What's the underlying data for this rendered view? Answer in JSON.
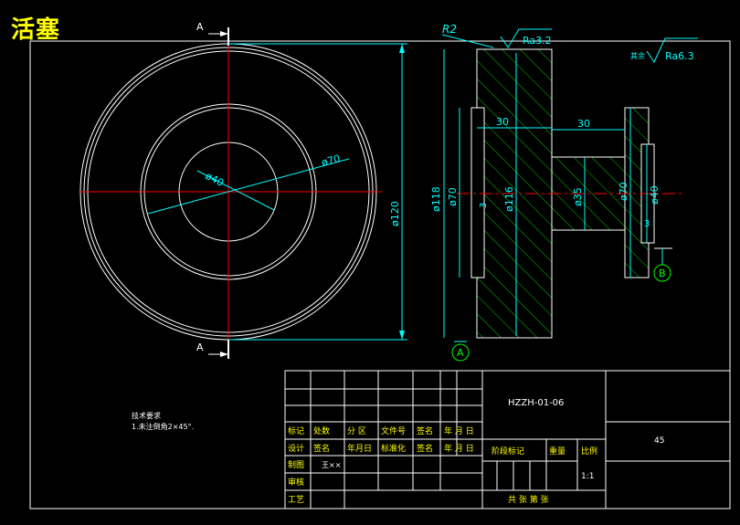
{
  "drawing": {
    "title": "活塞",
    "section_label_top": "A",
    "section_label_bottom": "A",
    "datum_a": "A",
    "datum_b": "B",
    "radius_label": "R2",
    "roughness_top": "Ra3.2",
    "roughness_other_prefix": "其余",
    "roughness_other": "Ra6.3",
    "dims_front": {
      "d120": "ø120",
      "d70": "ø70",
      "d40": "ø40"
    },
    "dims_side": {
      "d118": "ø118",
      "d70_left": "ø70",
      "d116": "ø116",
      "d35": "ø35",
      "d70_right": "ø70",
      "d40": "ø40",
      "w30_left": "30",
      "w30_right": "30",
      "d3_left": "3",
      "d3_right": "3"
    },
    "notes": [
      "技术要求",
      "1.未注倒角2×45°."
    ]
  },
  "title_block": {
    "drawing_no": "HZZH-01-06",
    "material": "45",
    "scale": "1:1",
    "row_labels": [
      "标记",
      "处数",
      "分 区",
      "文件号",
      "签名",
      "年 月 日"
    ],
    "row2_labels": [
      "设计",
      "签名",
      "年月日",
      "标准化",
      "签名",
      "年 月 日"
    ],
    "stage_label": "阶段标记",
    "weight_label": "重量",
    "scale_label": "比例",
    "draw_label": "制图",
    "draw_name": "王××",
    "review_label": "审核",
    "process_label": "工艺",
    "sheet_text": "共    张 第    张"
  }
}
